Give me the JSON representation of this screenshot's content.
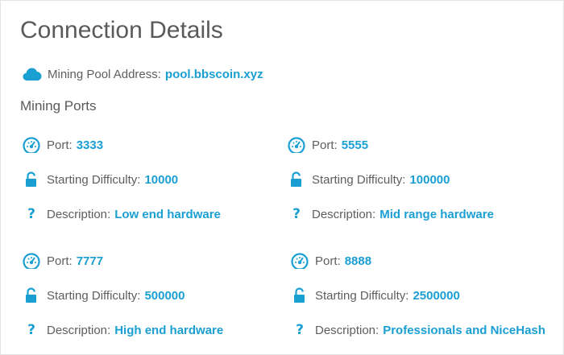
{
  "title": "Connection Details",
  "pool": {
    "label": "Mining Pool Address:",
    "value": "pool.bbscoin.xyz"
  },
  "ports_heading": "Mining Ports",
  "accent_color": "#1a9fd3",
  "ports": [
    {
      "port_label": "Port:",
      "port": "3333",
      "difficulty_label": "Starting Difficulty:",
      "difficulty": "10000",
      "description_label": "Description:",
      "description": "Low end hardware"
    },
    {
      "port_label": "Port:",
      "port": "5555",
      "difficulty_label": "Starting Difficulty:",
      "difficulty": "100000",
      "description_label": "Description:",
      "description": "Mid range hardware"
    },
    {
      "port_label": "Port:",
      "port": "7777",
      "difficulty_label": "Starting Difficulty:",
      "difficulty": "500000",
      "description_label": "Description:",
      "description": "High end hardware"
    },
    {
      "port_label": "Port:",
      "port": "8888",
      "difficulty_label": "Starting Difficulty:",
      "difficulty": "2500000",
      "description_label": "Description:",
      "description": "Professionals and NiceHash"
    }
  ],
  "icons": {
    "pool": "cloud-icon",
    "port": "speedometer-icon",
    "difficulty": "unlock-icon",
    "description": "question-icon"
  }
}
